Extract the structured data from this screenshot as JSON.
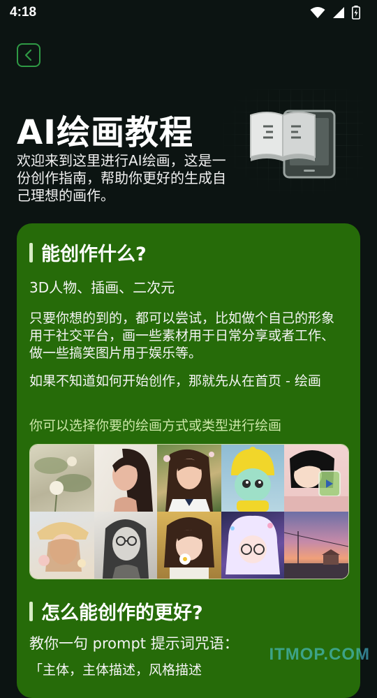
{
  "status": {
    "time": "4:18"
  },
  "header": {
    "title": "AI绘画教程",
    "intro": "欢迎来到这里进行AI绘画，这是一份创作指南，帮助你更好的生成自己理想的画作。"
  },
  "section1": {
    "title": "能创作什么?",
    "subtitle": "3D人物、插画、二次元",
    "para1": "只要你想的到的，都可以尝试，比如做个自己的形象用于社交平台，画一些素材用于日常分享或者工作、做一些搞笑图片用于娱乐等。",
    "para2": "如果不知道如何开始创作，那就先从在首页 - 绘画",
    "accent": "你可以选择你要的绘画方式或类型进行绘画"
  },
  "section2": {
    "title": "怎么能创作的更好?",
    "para1": "教你一句 prompt 提示词咒语：",
    "para2": "「主体，主体描述，风格描述"
  },
  "watermark": "ITMOP.COM",
  "icons": [
    "wifi-icon",
    "signal-icon",
    "battery-icon",
    "chevron-left-icon",
    "book-icon",
    "tablet-icon"
  ],
  "colors": {
    "background": "#0c1412",
    "card": "#266b09",
    "accent_text": "#cbe7a8",
    "back_border": "#2f9a45"
  }
}
